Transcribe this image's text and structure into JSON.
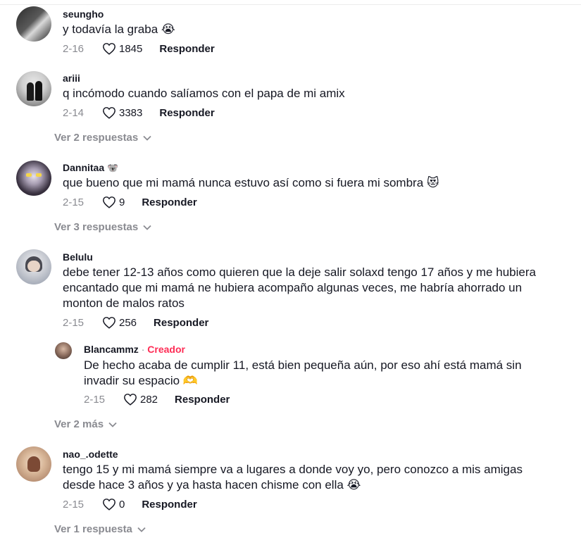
{
  "comments": [
    {
      "username": "seungho",
      "text": "y todavía la graba",
      "emoji": "😭",
      "date": "2-16",
      "likes": "1845",
      "reply_label": "Responder"
    },
    {
      "username": "ariii",
      "text": "q incómodo cuando salíamos con el papa de mi amix",
      "date": "2-14",
      "likes": "3383",
      "reply_label": "Responder",
      "view_more": "Ver 2 respuestas"
    },
    {
      "username": "Dannitaa",
      "username_emoji": "🐨",
      "text": "que bueno que mi mamá nunca estuvo así como si fuera mi sombra",
      "emoji": "😻",
      "date": "2-15",
      "likes": "9",
      "reply_label": "Responder",
      "view_more": "Ver 3 respuestas"
    },
    {
      "username": "Belulu",
      "text_lines": [
        "debe tener 12-13 años como quieren que la deje salir solaxd tengo 17 años y me hubiera",
        "encantado que mi mamá ne hubiera acompaño algunas veces, me habría ahorrado un",
        "monton de malos ratos"
      ],
      "date": "2-15",
      "likes": "256",
      "reply_label": "Responder",
      "reply": {
        "username": "Blancammz",
        "separator": "·",
        "badge": "Creador",
        "text_lines": [
          "De hecho acaba de cumplir 11, está bien pequeña aún, por eso ahí está mamá sin",
          "invadir su espacio"
        ],
        "emoji": "🫶",
        "date": "2-15",
        "likes": "282",
        "reply_label": "Responder"
      },
      "view_more": "Ver 2 más"
    },
    {
      "username": "nao_.odette",
      "text_lines": [
        "tengo 15 y mi mamá siempre va a lugares a donde voy yo, pero conozco a mis amigas",
        "desde hace 3 años y ya hasta hacen chisme con ella"
      ],
      "emoji": "😭",
      "date": "2-15",
      "likes": "0",
      "reply_label": "Responder",
      "view_more": "Ver 1 respuesta"
    }
  ],
  "colors": {
    "text": "#161823",
    "muted": "#8a8b91",
    "creator": "#fe2c55"
  }
}
